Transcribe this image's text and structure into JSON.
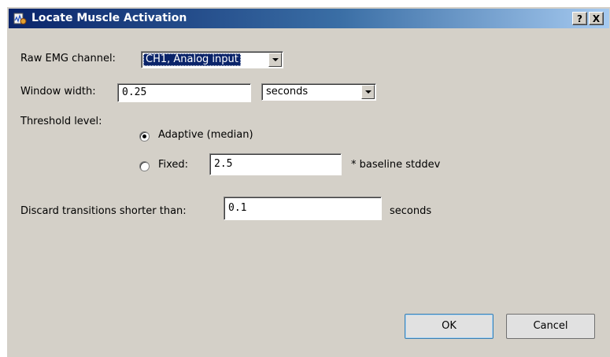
{
  "window": {
    "title": "Locate Muscle Activation",
    "help_label": "?",
    "close_label": "X"
  },
  "channel": {
    "label": "Raw EMG channel:",
    "value": "CH1, Analog input"
  },
  "window_width": {
    "label": "Window width:",
    "value": "0.25",
    "unit": "seconds"
  },
  "threshold": {
    "label": "Threshold level:",
    "adaptive_label": "Adaptive (median)",
    "adaptive_checked": true,
    "fixed_label": "Fixed:",
    "fixed_checked": false,
    "fixed_value": "2.5",
    "fixed_suffix": "* baseline stddev"
  },
  "discard": {
    "label": "Discard transitions shorter than:",
    "value": "0.1",
    "unit": "seconds"
  },
  "buttons": {
    "ok": "OK",
    "cancel": "Cancel"
  },
  "colors": {
    "titlebar_start": "#0a246a",
    "titlebar_end": "#a6caf0",
    "dialog_bg": "#d4d0c8"
  }
}
